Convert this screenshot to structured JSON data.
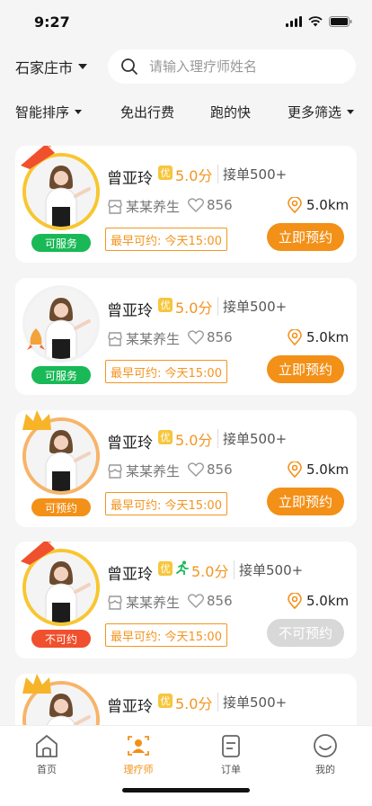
{
  "status_bar": {
    "time": "9:27"
  },
  "header": {
    "city": "石家庄市",
    "search_placeholder": "请输入理疗师姓名"
  },
  "filters": [
    {
      "label": "智能排序",
      "has_caret": true
    },
    {
      "label": "免出行费",
      "has_caret": false
    },
    {
      "label": "跑的快",
      "has_caret": false
    },
    {
      "label": "更多筛选",
      "has_caret": true
    }
  ],
  "therapists": [
    {
      "name": "曾亚玲",
      "badge": "优",
      "fast_icon": false,
      "score": "5.0分",
      "orders": "接单500+",
      "shop": "某某养生",
      "likes": "856",
      "distance": "5.0km",
      "earliest": "最早可约: 今天15:00",
      "status": "可服务",
      "status_color": "#18b956",
      "ring": "new",
      "tag": "新人",
      "button": "立即预约",
      "button_enabled": true
    },
    {
      "name": "曾亚玲",
      "badge": "优",
      "fast_icon": false,
      "score": "5.0分",
      "orders": "接单500+",
      "shop": "某某养生",
      "likes": "856",
      "distance": "5.0km",
      "earliest": "最早可约: 今天15:00",
      "status": "可服务",
      "status_color": "#18b956",
      "ring": "plain",
      "tag": "",
      "button": "立即预约",
      "button_enabled": true
    },
    {
      "name": "曾亚玲",
      "badge": "优",
      "fast_icon": false,
      "score": "5.0分",
      "orders": "接单500+",
      "shop": "某某养生",
      "likes": "856",
      "distance": "5.0km",
      "earliest": "最早可约: 今天15:00",
      "status": "可预约",
      "status_color": "#f39018",
      "ring": "top",
      "tag": "",
      "button": "立即预约",
      "button_enabled": true
    },
    {
      "name": "曾亚玲",
      "badge": "优",
      "fast_icon": true,
      "score": "5.0分",
      "orders": "接单500+",
      "shop": "某某养生",
      "likes": "856",
      "distance": "5.0km",
      "earliest": "最早可约: 今天15:00",
      "status": "不可约",
      "status_color": "#f0502d",
      "ring": "new",
      "tag": "新人",
      "button": "不可预约",
      "button_enabled": false
    },
    {
      "name": "曾亚玲",
      "badge": "优",
      "fast_icon": false,
      "score": "5.0分",
      "orders": "接单500+",
      "shop": "",
      "likes": "",
      "distance": "",
      "earliest": "",
      "status": "",
      "status_color": "",
      "ring": "top",
      "tag": "",
      "button": "",
      "button_enabled": true
    }
  ],
  "tab_bar": [
    {
      "label": "首页",
      "icon": "home-icon",
      "active": false
    },
    {
      "label": "理疗师",
      "icon": "therapist-icon",
      "active": true
    },
    {
      "label": "订单",
      "icon": "order-icon",
      "active": false
    },
    {
      "label": "我的",
      "icon": "profile-icon",
      "active": false
    }
  ],
  "colors": {
    "accent": "#f39018",
    "score": "#f39521",
    "available": "#18b956",
    "unavailable": "#f0502d",
    "badge": "#f6c63c"
  }
}
